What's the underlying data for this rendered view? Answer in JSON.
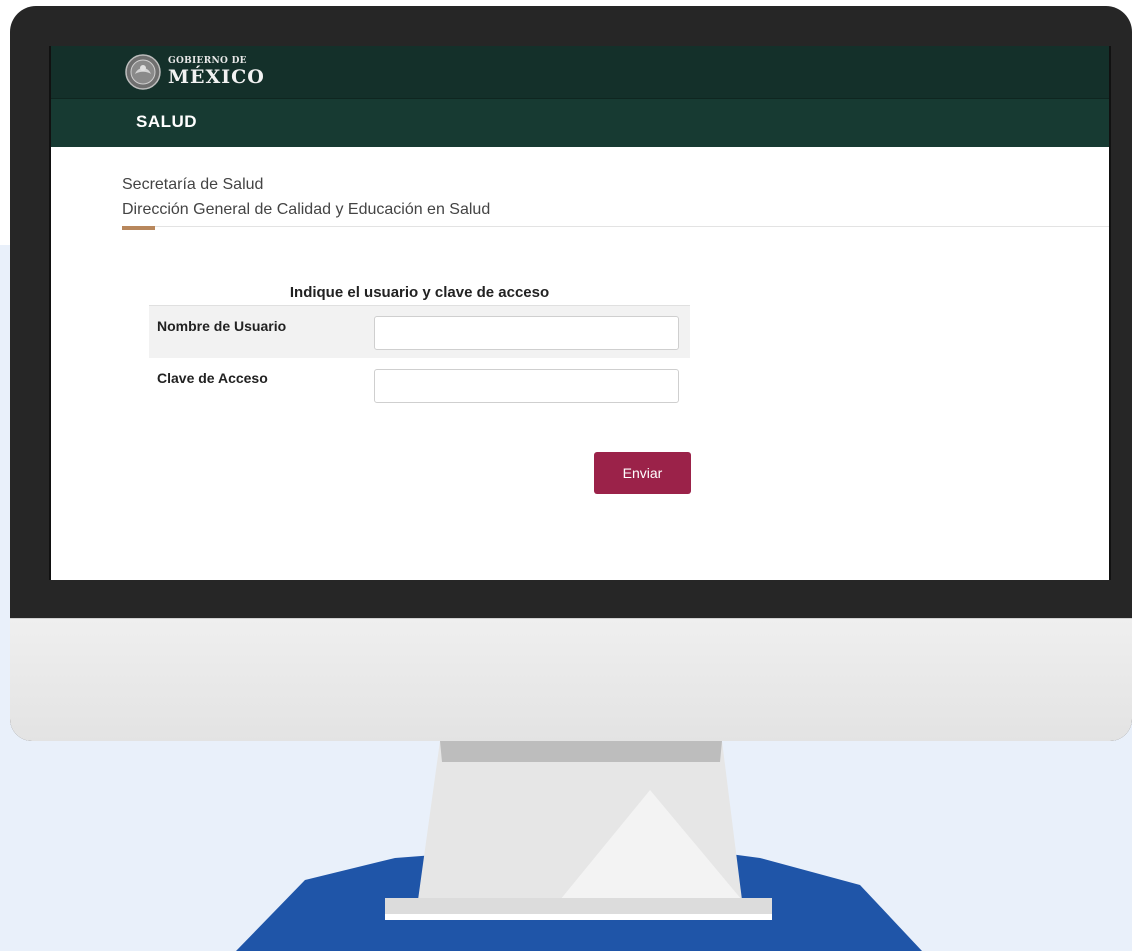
{
  "header": {
    "gov_line1": "GOBIERNO DE",
    "gov_line2": "MÉXICO",
    "section": "SALUD"
  },
  "organization": {
    "line1": "Secretaría de Salud",
    "line2": "Dirección General de Calidad y Educación en Salud"
  },
  "login_form": {
    "title": "Indique el usuario y clave de acceso",
    "username_label": "Nombre de Usuario",
    "username_value": "",
    "password_label": "Clave de Acceso",
    "password_value": "",
    "submit_label": "Enviar"
  },
  "colors": {
    "header_dark": "#14302a",
    "header_green": "#173a32",
    "accent_gold": "#b8875c",
    "button_maroon": "#9b2249",
    "base_blue": "#1f55a8"
  }
}
